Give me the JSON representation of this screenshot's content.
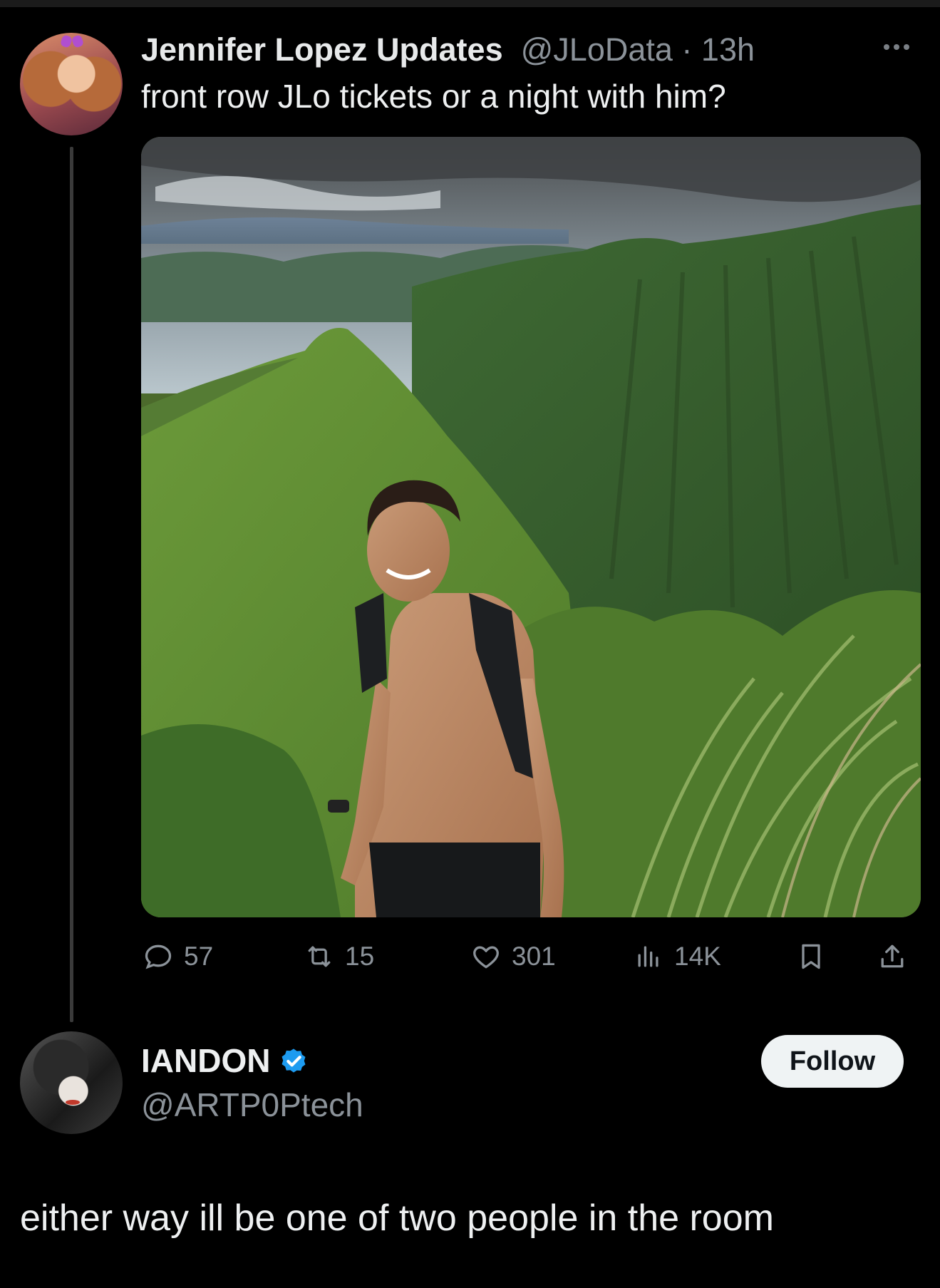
{
  "tweet": {
    "display_name": "Jennifer Lopez Updates",
    "handle": "@JLoData",
    "separator": " · ",
    "time": "13h",
    "text": "front row JLo tickets or a night with him?",
    "media_icon": "photo-mountain-hiker",
    "stats": {
      "replies": "57",
      "retweets": "15",
      "likes": "301",
      "views": "14K"
    },
    "icons": [
      "more-icon",
      "reply-icon",
      "retweet-icon",
      "like-icon",
      "views-icon",
      "bookmark-icon",
      "share-icon"
    ]
  },
  "reply": {
    "display_name": "IANDON",
    "handle": "@ARTP0Ptech",
    "verified": true,
    "follow_label": "Follow",
    "text": "either way ill be one of two people in the room"
  },
  "colors": {
    "background": "#000000",
    "text": "#e7e9ea",
    "secondary": "#8b9299",
    "verified": "#1d9bf0",
    "follow_bg": "#eff3f4"
  }
}
